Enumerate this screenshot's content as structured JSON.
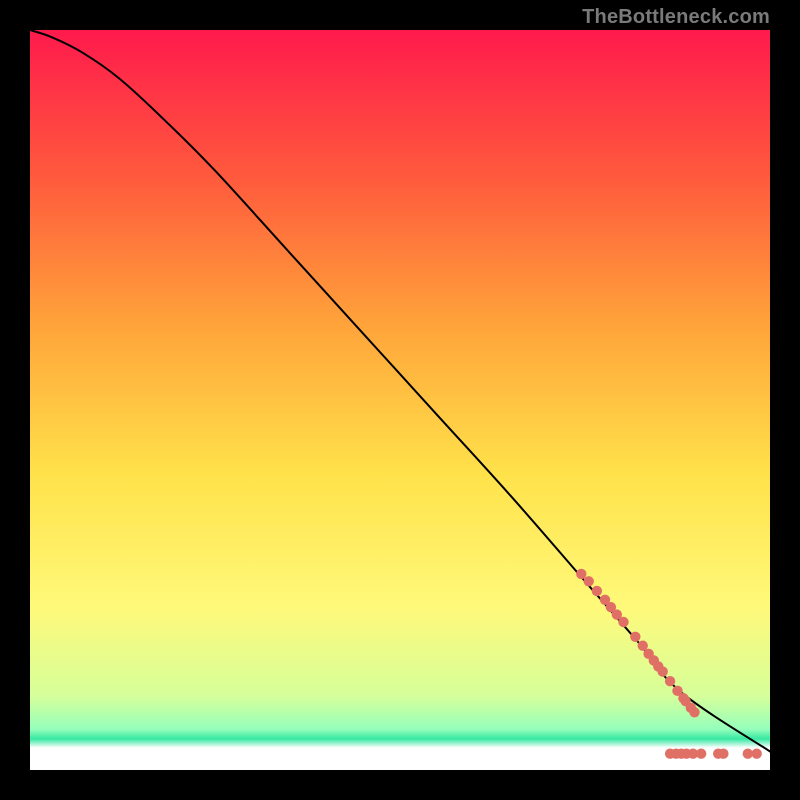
{
  "watermark": "TheBottleneck.com",
  "chart_data": {
    "type": "line",
    "title": "",
    "xlabel": "",
    "ylabel": "",
    "xlim": [
      0,
      100
    ],
    "ylim": [
      0,
      100
    ],
    "gradient_stops": [
      {
        "t": 0.0,
        "color": "#ff1a4c"
      },
      {
        "t": 0.2,
        "color": "#ff5a3d"
      },
      {
        "t": 0.4,
        "color": "#ffa43a"
      },
      {
        "t": 0.6,
        "color": "#ffe24a"
      },
      {
        "t": 0.78,
        "color": "#fff97a"
      },
      {
        "t": 0.9,
        "color": "#d6ff9a"
      },
      {
        "t": 0.945,
        "color": "#95ffbc"
      },
      {
        "t": 0.958,
        "color": "#36e8a2"
      },
      {
        "t": 0.97,
        "color": "#ffffff"
      },
      {
        "t": 1.0,
        "color": "#ffffff"
      }
    ],
    "series": [
      {
        "name": "curve",
        "stroke": "#000000",
        "stroke_width": 2,
        "x": [
          0,
          3,
          7,
          12,
          18,
          25,
          35,
          45,
          55,
          65,
          75,
          82,
          88,
          100
        ],
        "y": [
          100,
          99,
          97,
          93.5,
          88,
          81,
          70,
          59,
          48,
          37,
          25.5,
          17.5,
          10.5,
          2.5
        ]
      }
    ],
    "markers": {
      "color": "#e07066",
      "radius": 5.2,
      "points": [
        {
          "x": 74.5,
          "y": 26.5
        },
        {
          "x": 75.5,
          "y": 25.5
        },
        {
          "x": 76.6,
          "y": 24.2
        },
        {
          "x": 77.7,
          "y": 23.0
        },
        {
          "x": 78.5,
          "y": 22.0
        },
        {
          "x": 79.3,
          "y": 21.0
        },
        {
          "x": 80.2,
          "y": 20.0
        },
        {
          "x": 81.8,
          "y": 18.0
        },
        {
          "x": 82.8,
          "y": 16.8
        },
        {
          "x": 83.6,
          "y": 15.7
        },
        {
          "x": 84.3,
          "y": 14.8
        },
        {
          "x": 84.9,
          "y": 14.0
        },
        {
          "x": 85.5,
          "y": 13.3
        },
        {
          "x": 86.5,
          "y": 12.0
        },
        {
          "x": 87.5,
          "y": 10.7
        },
        {
          "x": 88.3,
          "y": 9.7
        },
        {
          "x": 88.6,
          "y": 9.3
        },
        {
          "x": 89.3,
          "y": 8.4
        },
        {
          "x": 89.8,
          "y": 7.8
        },
        {
          "x": 86.5,
          "y": 2.2
        },
        {
          "x": 87.3,
          "y": 2.2
        },
        {
          "x": 88.0,
          "y": 2.2
        },
        {
          "x": 88.7,
          "y": 2.2
        },
        {
          "x": 89.6,
          "y": 2.2
        },
        {
          "x": 90.7,
          "y": 2.2
        },
        {
          "x": 93.0,
          "y": 2.2
        },
        {
          "x": 93.7,
          "y": 2.2
        },
        {
          "x": 97.0,
          "y": 2.2
        },
        {
          "x": 98.2,
          "y": 2.2
        }
      ]
    }
  }
}
